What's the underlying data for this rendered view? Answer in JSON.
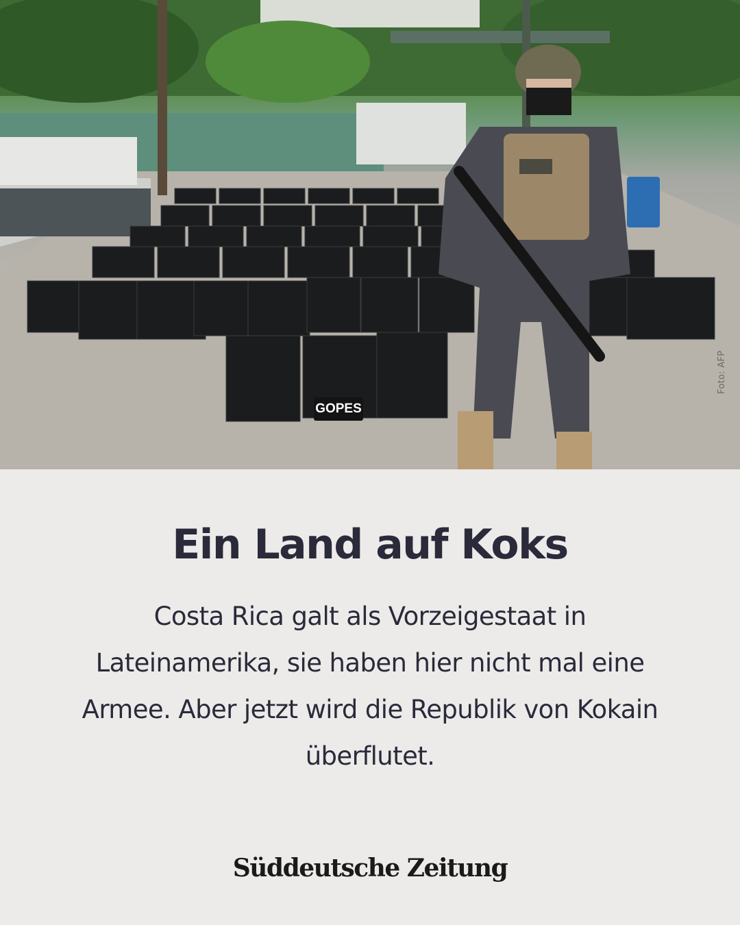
{
  "photo": {
    "alt_icon": "photo-police-cocaine-seizure",
    "credit": "Foto: AFP",
    "sign_text": "GOPES",
    "vest_text": "GOPES"
  },
  "article": {
    "headline": "Ein Land auf Koks",
    "teaser": "Costa Rica galt als Vorzeigestaat in Lateinamerika, sie haben hier nicht mal eine Armee. Aber jetzt wird die Republik von Kokain überflutet."
  },
  "brand": {
    "logo_text": "Süddeutsche Zeitung"
  },
  "colors": {
    "panel_background": "#ecebe9",
    "text": "#2a2a3a"
  }
}
